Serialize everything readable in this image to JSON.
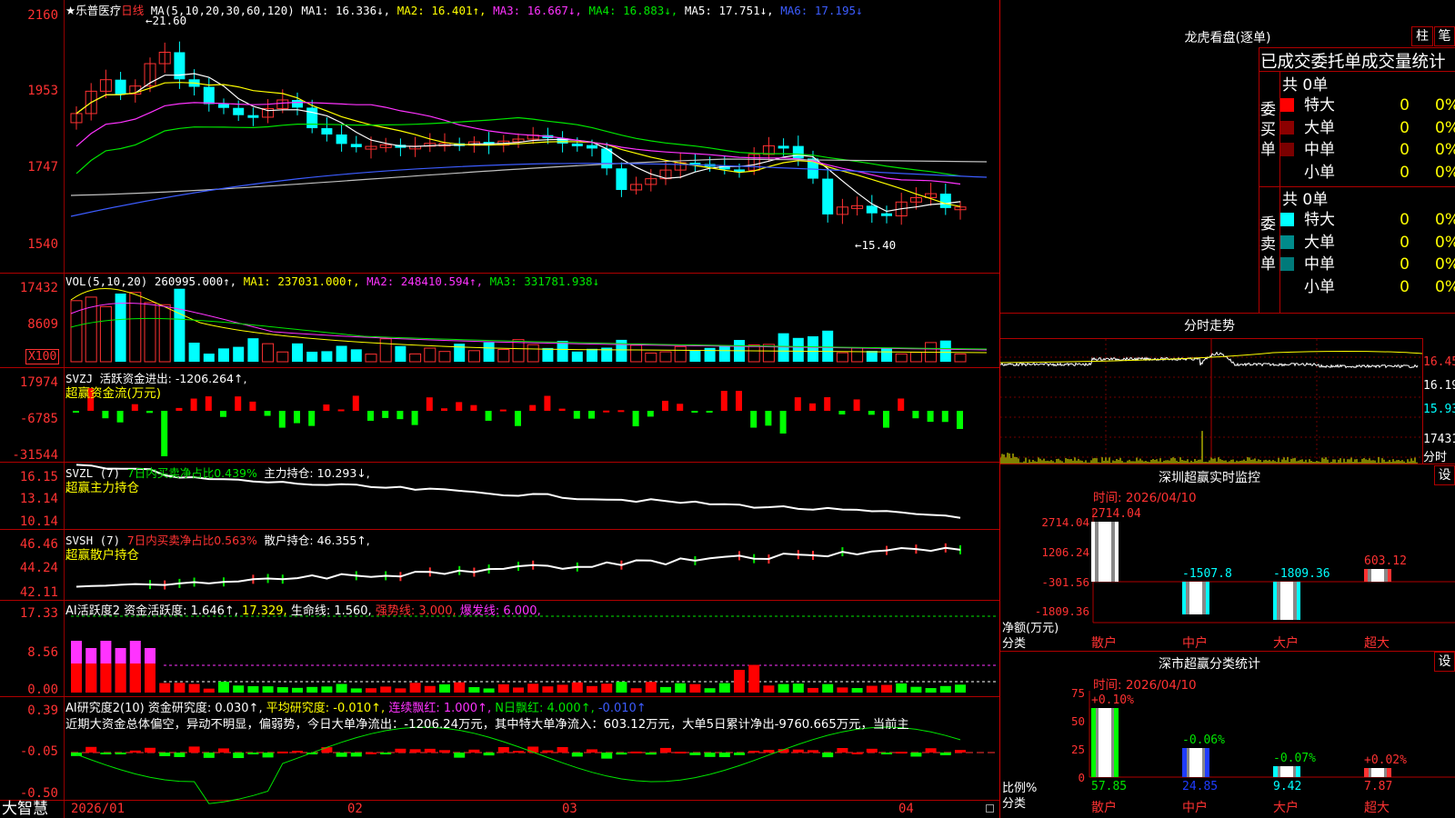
{
  "app": {
    "name": "大智慧"
  },
  "stock": {
    "name": "★乐普医疗",
    "period": "日线",
    "high_mark": "21.60",
    "low_mark": "15.40"
  },
  "main_chart": {
    "yticks": [
      "2160",
      "1953",
      "1747",
      "1540"
    ],
    "ma": {
      "label": "MA(5,10,20,30,60,120)",
      "ma1": "MA1: 16.336↓,",
      "ma2": "MA2: 16.401↑,",
      "ma3": "MA3: 16.667↓,",
      "ma4": "MA4: 16.883↓,",
      "ma5": "MA5: 17.751↓,",
      "ma6": "MA6: 17.195↓"
    }
  },
  "vol_panel": {
    "label": "VOL(5,10,20)",
    "value": "260995.000↑,",
    "ma1": "MA1: 237031.000↑,",
    "ma2": "MA2: 248410.594↑,",
    "ma3": "MA3: 331781.938↓",
    "yticks": [
      "17432",
      "8609"
    ],
    "unit": "X100"
  },
  "svzj_panel": {
    "label": "SVZJ",
    "desc": "活跃资金进出: -1206.264↑,",
    "title": "超赢资金流(万元)",
    "yticks": [
      "17974",
      "-6785",
      "-31544"
    ]
  },
  "svzl_panel": {
    "label": "SVZL (7)",
    "desc1": "7日内买卖净占比0.439%",
    "desc2": "主力持仓: 10.293↓,",
    "title": "超赢主力持仓",
    "yticks": [
      "16.15",
      "13.14",
      "10.14"
    ]
  },
  "svsh_panel": {
    "label": "SVSH (7)",
    "desc1": "7日内买卖净占比0.563%",
    "desc2": "散户持仓: 46.355↑,",
    "title": "超赢散户持仓",
    "yticks": [
      "46.46",
      "44.24",
      "42.11"
    ]
  },
  "ai2_panel": {
    "label": "AI活跃度2",
    "d1": "资金活跃度: 1.646↑,",
    "d2": "17.329,",
    "d3": "生命线: 1.560,",
    "d4": "强势线: 3.000,",
    "d5": "爆发线: 6.000,",
    "yticks": [
      "17.33",
      "8.56",
      "0.00"
    ]
  },
  "ai_research_panel": {
    "label": "AI研究度2(10)",
    "d1": "资金研究度: 0.030↑,",
    "d2": "平均研究度: -0.010↑,",
    "d3": "连续飘红: 1.000↑,",
    "d4": "N日飘红: 4.000↑,",
    "d5": "-0.010↑",
    "summary": "近期大资金总体偏空，异动不明显，偏弱势，今日大单净流出：-1206.24万元，其中特大单净流入：603.12万元，大单5日累计净出-9760.665万元，当前主",
    "yticks": [
      "0.39",
      "-0.05",
      "-0.50"
    ]
  },
  "xaxis": {
    "labels": [
      "2026/01",
      "02",
      "03",
      "04"
    ]
  },
  "longhu": {
    "title": "龙虎看盘(逐单)",
    "btn1": "柱",
    "btn2": "笔",
    "subtitle": "已成交委托单成交量统计",
    "buy_side": "委买单",
    "sell_side": "委卖单",
    "buy_total": "共 0单",
    "sell_total": "共 0单",
    "buy_rows": [
      {
        "label": "特大",
        "v": "0",
        "p": "0%",
        "color": "#ff0000"
      },
      {
        "label": "大单",
        "v": "0",
        "p": "0%",
        "color": "#8b0000"
      },
      {
        "label": "中单",
        "v": "0",
        "p": "0%",
        "color": "#7a0000"
      },
      {
        "label": "小单",
        "v": "0",
        "p": "0%",
        "color": "#000000"
      }
    ],
    "sell_rows": [
      {
        "label": "特大",
        "v": "0",
        "p": "0%",
        "color": "#00ffff"
      },
      {
        "label": "大单",
        "v": "0",
        "p": "0%",
        "color": "#008b8b"
      },
      {
        "label": "中单",
        "v": "0",
        "p": "0%",
        "color": "#007a7a"
      },
      {
        "label": "小单",
        "v": "0",
        "p": "0%",
        "color": "#000000"
      }
    ]
  },
  "intraday": {
    "title": "分时走势",
    "yticks": [
      "16.45",
      "16.19",
      "15.93"
    ],
    "vol_tick": "17431",
    "unit": "分时"
  },
  "sz_monitor": {
    "title": "深圳超赢实时监控",
    "btn": "设",
    "time": "时间: 2026/04/10",
    "yticks": [
      "2714.04",
      "1206.24",
      "-301.56",
      "-1809.36"
    ],
    "ylabel": "净额(万元)",
    "xlabel": "分类",
    "categories": [
      "散户",
      "中户",
      "大户",
      "超大"
    ],
    "values": [
      "2714.04",
      "-1507.8",
      "-1809.36",
      "603.12"
    ]
  },
  "sz_class": {
    "title": "深市超赢分类统计",
    "btn": "设",
    "time": "时间: 2026/04/10",
    "yticks": [
      "75",
      "50",
      "25",
      "0"
    ],
    "ylabel": "比例%",
    "xlabel": "分类",
    "categories": [
      "散户",
      "中户",
      "大户",
      "超大"
    ],
    "changes": [
      "+0.10%",
      "-0.06%",
      "-0.07%",
      "+0.02%"
    ],
    "values": [
      "57.85",
      "24.85",
      "9.42",
      "7.87"
    ]
  }
}
